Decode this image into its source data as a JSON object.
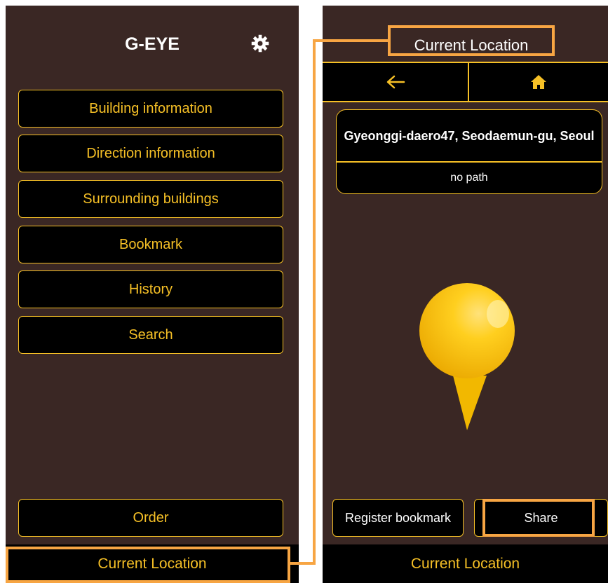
{
  "left_screen": {
    "app_title": "G-EYE",
    "settings_icon": "gear-icon",
    "menu": [
      {
        "label": "Building information"
      },
      {
        "label": "Direction information"
      },
      {
        "label": "Surrounding buildings"
      },
      {
        "label": "Bookmark"
      },
      {
        "label": "History"
      },
      {
        "label": "Search"
      }
    ],
    "order_label": "Order",
    "bottom_label": "Current Location"
  },
  "right_screen": {
    "header_title": "Current Location",
    "back_icon": "arrow-left-icon",
    "home_icon": "home-icon",
    "address": "Gyeonggi-daero47, Seodaemun-gu, Seoul",
    "path_status": "no path",
    "pin_icon": "map-pin-icon",
    "register_bookmark_label": "Register bookmark",
    "share_label": "Share",
    "bottom_label": "Current Location"
  },
  "colors": {
    "background": "#3a2724",
    "accent": "#f6c026",
    "highlight": "#f7a543",
    "bar": "#000000"
  }
}
